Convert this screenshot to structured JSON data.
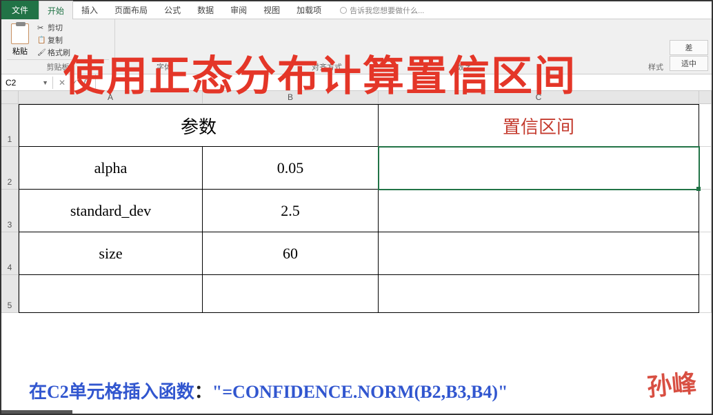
{
  "tabs": {
    "file": "文件",
    "home": "开始",
    "insert": "插入",
    "layout": "页面布局",
    "formula": "公式",
    "data": "数据",
    "review": "审阅",
    "view": "视图",
    "addins": "加载项",
    "tell_me": "告诉我您想要做什么..."
  },
  "ribbon": {
    "paste": "粘贴",
    "cut": "剪切",
    "copy": "复制",
    "format_painter": "格式刷",
    "clipboard": "剪贴板",
    "font": "字体",
    "alignment": "对齐方式",
    "number": "数字",
    "styles": "样式",
    "bad": "差",
    "neutral": "适中"
  },
  "overlay_title": "使用正态分布计算置信区间",
  "name_box": "C2",
  "columns": {
    "a": "A",
    "b": "B",
    "c": "C"
  },
  "rows": {
    "r1": "1",
    "r2": "2",
    "r3": "3",
    "r4": "4",
    "r5": "5"
  },
  "table": {
    "header_params": "参数",
    "header_ci": "置信区间",
    "rows": [
      {
        "label": "alpha",
        "value": "0.05"
      },
      {
        "label": "standard_dev",
        "value": "2.5"
      },
      {
        "label": "size",
        "value": "60"
      }
    ]
  },
  "instruction": {
    "prefix": "在C2单元格插入函数",
    "colon": "：",
    "formula": "\"=CONFIDENCE.NORM(B2,B3,B4)\""
  },
  "watermark": "孙峰"
}
